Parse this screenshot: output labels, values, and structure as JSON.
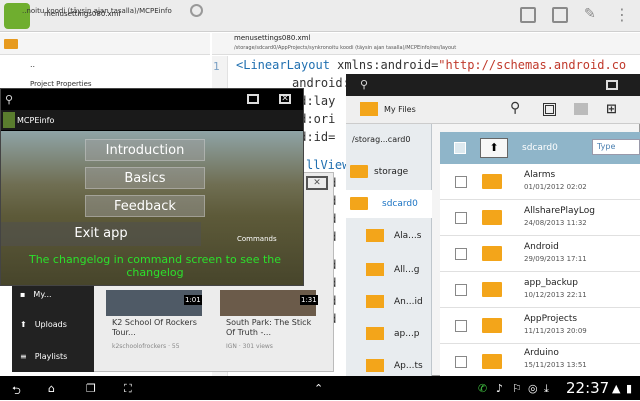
{
  "top_bar": {
    "file_name": "menusettings080.xml"
  },
  "project_panel": {
    "path": "..noitu koodi (täysin ajan tasalla)/MCPEinfo",
    "up_label": "..",
    "tree_item": "Project Properties"
  },
  "editor": {
    "title": "menusettings080.xml",
    "path": "/storage/sdcard0/AppProjects/synkronoitu koodi (täysin ajan tasalla)/MCPEinfo/res/layout",
    "line1_number": "1",
    "line1_tag": "<LinearLayout",
    "line1_attr": " xmlns:android=",
    "line1_value": "\"http://schemas.android.co",
    "lines": [
      "android:lay",
      "id:lay",
      "id:ori",
      "id:id="
    ],
    "lines2": [
      "llView",
      "id",
      "id",
      "id",
      "id"
    ],
    "lines3": [
      "id",
      "id",
      "id",
      "id"
    ]
  },
  "mcpe_window": {
    "title": "MCPEinfo",
    "menu": [
      "Introduction",
      "Basics",
      "Feedback"
    ],
    "exit_label": "Exit app",
    "commands_label": "Commands",
    "changelog_text": "The changelog in command screen to see the changelog"
  },
  "youtube": {
    "nav": [
      "My...",
      "Uploads",
      "Playlists"
    ],
    "videos": [
      {
        "title": "K2 School Of Rockers Tour...",
        "channel": "k2schoolofrockers · 55",
        "duration": "1:01"
      },
      {
        "title": "South Park: The Stick Of Truth -...",
        "channel": "IGN · 301 views",
        "duration": "1:31"
      }
    ]
  },
  "my_files": {
    "title": "My Files",
    "storage_path": "/storag...card0",
    "left_items": [
      "storage",
      "sdcard0"
    ],
    "sub_items": [
      "Ala...s",
      "All...g",
      "An...id",
      "ap...p",
      "Ap...ts"
    ],
    "current_folder": "sdcard0",
    "sort_label": "Type",
    "files": [
      {
        "name": "Alarms",
        "date": "01/01/2012 02:02"
      },
      {
        "name": "AllsharePlayLog",
        "date": "24/08/2013 11:32"
      },
      {
        "name": "Android",
        "date": "29/09/2013 17:11"
      },
      {
        "name": "app_backup",
        "date": "10/12/2013 22:11"
      },
      {
        "name": "AppProjects",
        "date": "11/11/2013 20:09"
      },
      {
        "name": "Arduino",
        "date": "15/11/2013 13:51"
      }
    ]
  },
  "status_bar": {
    "time": "22:37"
  },
  "colors": {
    "changelog_green": "#2ce02c",
    "folder_orange": "#f3a51a",
    "files_header": "#8fb5c9"
  }
}
